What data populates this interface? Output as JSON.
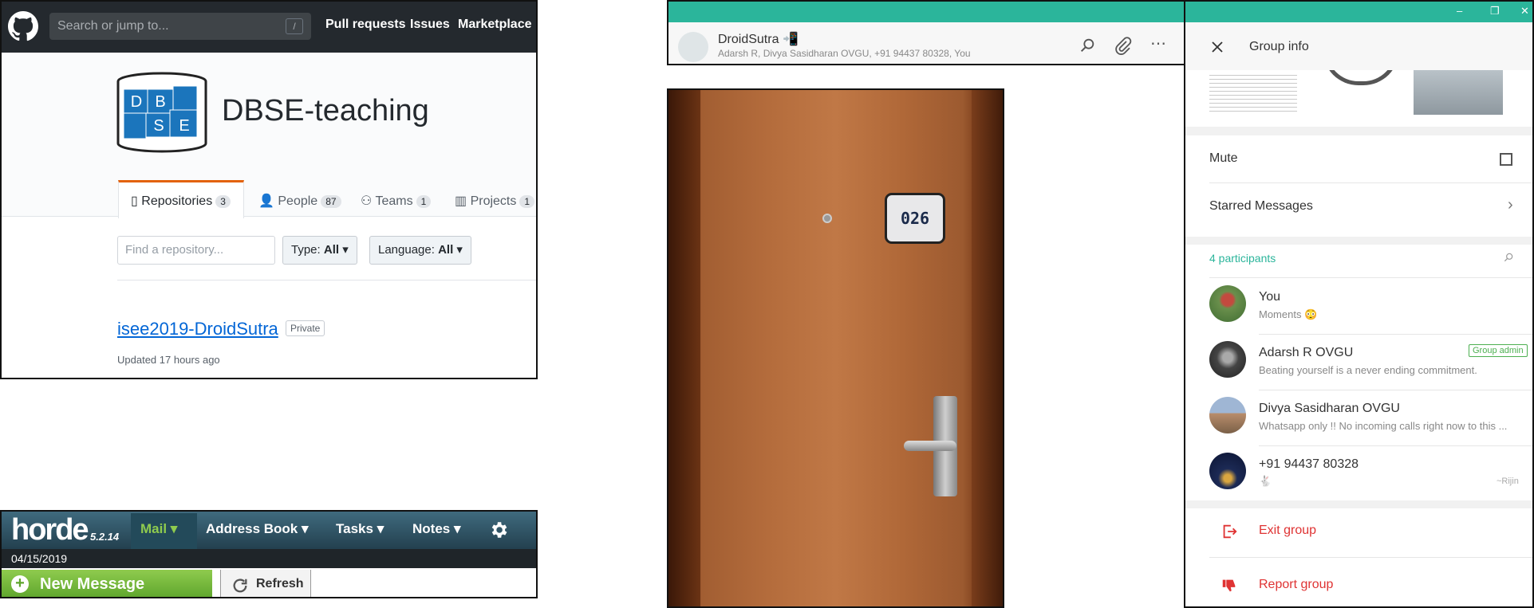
{
  "github": {
    "search_placeholder": "Search or jump to...",
    "slash_key": "/",
    "nav": [
      "Pull requests",
      "Issues",
      "Marketplace"
    ],
    "org_name": "DBSE-teaching",
    "logo_letters": [
      "D",
      "B",
      "S",
      "E"
    ],
    "tabs": [
      {
        "label": "Repositories",
        "count": "3"
      },
      {
        "label": "People",
        "count": "87"
      },
      {
        "label": "Teams",
        "count": "1"
      },
      {
        "label": "Projects",
        "count": "1"
      }
    ],
    "find_placeholder": "Find a repository...",
    "type_label": "Type:",
    "type_value": "All",
    "language_label": "Language:",
    "language_value": "All",
    "repo_name": "isee2019-DroidSutra",
    "private_badge": "Private",
    "updated": "Updated 17 hours ago"
  },
  "horde": {
    "logo": "horde",
    "version": "5.2.14",
    "menu": [
      "Mail",
      "Address Book",
      "Tasks",
      "Notes"
    ],
    "date": "04/15/2019",
    "new_message": "New Message",
    "refresh": "Refresh",
    "colors": {
      "active_menu": "#8fcb4e",
      "new_message": "#5ea52c"
    }
  },
  "whatsapp_chat": {
    "group_name": "DroidSutra",
    "members": "Adarsh R, Divya Sasidharan OVGU, +91 94437 80328, You",
    "accent": "#2bb59b"
  },
  "door": {
    "room_number": "026"
  },
  "group_info": {
    "window_controls": [
      "–",
      "❐",
      "✕"
    ],
    "title": "Group info",
    "mute_label": "Mute",
    "starred_label": "Starred Messages",
    "participants_label": "4 participants",
    "participants": [
      {
        "name": "You",
        "status": "Moments 😳",
        "badge": "",
        "note": ""
      },
      {
        "name": "Adarsh R OVGU",
        "status": "Beating yourself is a never ending commitment.",
        "badge": "Group admin",
        "note": ""
      },
      {
        "name": "Divya Sasidharan OVGU",
        "status": "Whatsapp only !! No incoming calls right now to this ...",
        "badge": "",
        "note": ""
      },
      {
        "name": "+91 94437 80328",
        "status": "🐇",
        "badge": "",
        "note": "~Rijin"
      }
    ],
    "exit_label": "Exit group",
    "report_label": "Report group",
    "accent": "#2bb59b",
    "danger": "#df3333"
  }
}
